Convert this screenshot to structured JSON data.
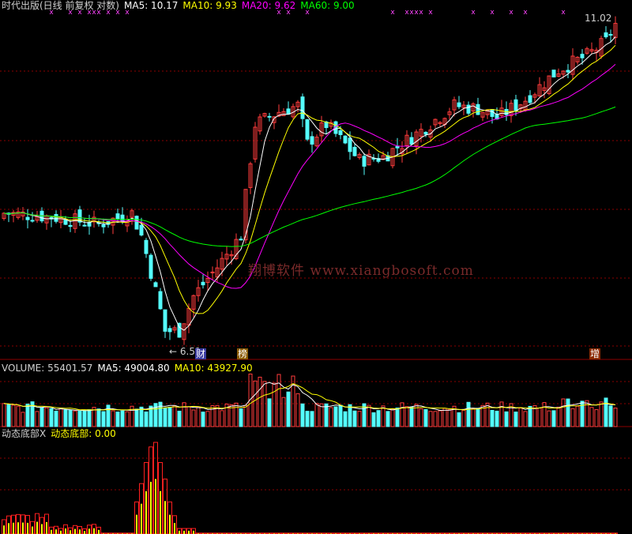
{
  "main_header": {
    "title": "时代出版(日线 前复权 对数)",
    "ma5": "MA5: 10.17",
    "ma10": "MA10: 9.93",
    "ma20": "MA20: 9.62",
    "ma60": "MA60: 9.00"
  },
  "volume_header": {
    "title": "VOLUME: 55401.57",
    "ma5": "MA5: 49004.80",
    "ma10": "MA10: 43927.90"
  },
  "indicator_header": {
    "title": "动态底部X",
    "value": "动态底部: 0.00"
  },
  "annotations": {
    "high_label": "11.02",
    "low_label": "6.51",
    "marker_cai": "财",
    "marker_bang": "榜",
    "marker_zeng": "增"
  },
  "watermark": "翔博软件 www.xiangbosoft.com",
  "colors": {
    "background": "#000000",
    "up": "#ff3c3c",
    "down": "#54fcfc",
    "ma5": "#ffffff",
    "ma10": "#ffff00",
    "ma20": "#ff00ff",
    "ma60": "#00ff00",
    "grid": "#8b0000",
    "indicator_outer": "#ff2020",
    "indicator_inner": "#ffff00"
  },
  "chart_data": [
    {
      "type": "candlestick",
      "title": "时代出版(日线 前复权 对数)",
      "scale": "log",
      "ylim": [
        6.3,
        11.3
      ],
      "high": 11.02,
      "low": 6.51,
      "series": [
        {
          "name": "MA5",
          "last": 10.17
        },
        {
          "name": "MA10",
          "last": 9.93
        },
        {
          "name": "MA20",
          "last": 9.62
        },
        {
          "name": "MA60",
          "last": 9.0
        }
      ]
    },
    {
      "type": "bar",
      "title": "VOLUME",
      "last_value": 55401.57,
      "series": [
        {
          "name": "MA5",
          "last": 49004.8
        },
        {
          "name": "MA10",
          "last": 43927.9
        }
      ]
    },
    {
      "type": "bar",
      "title": "动态底部X",
      "series": [
        {
          "name": "动态底部",
          "last": 0.0
        }
      ]
    }
  ]
}
